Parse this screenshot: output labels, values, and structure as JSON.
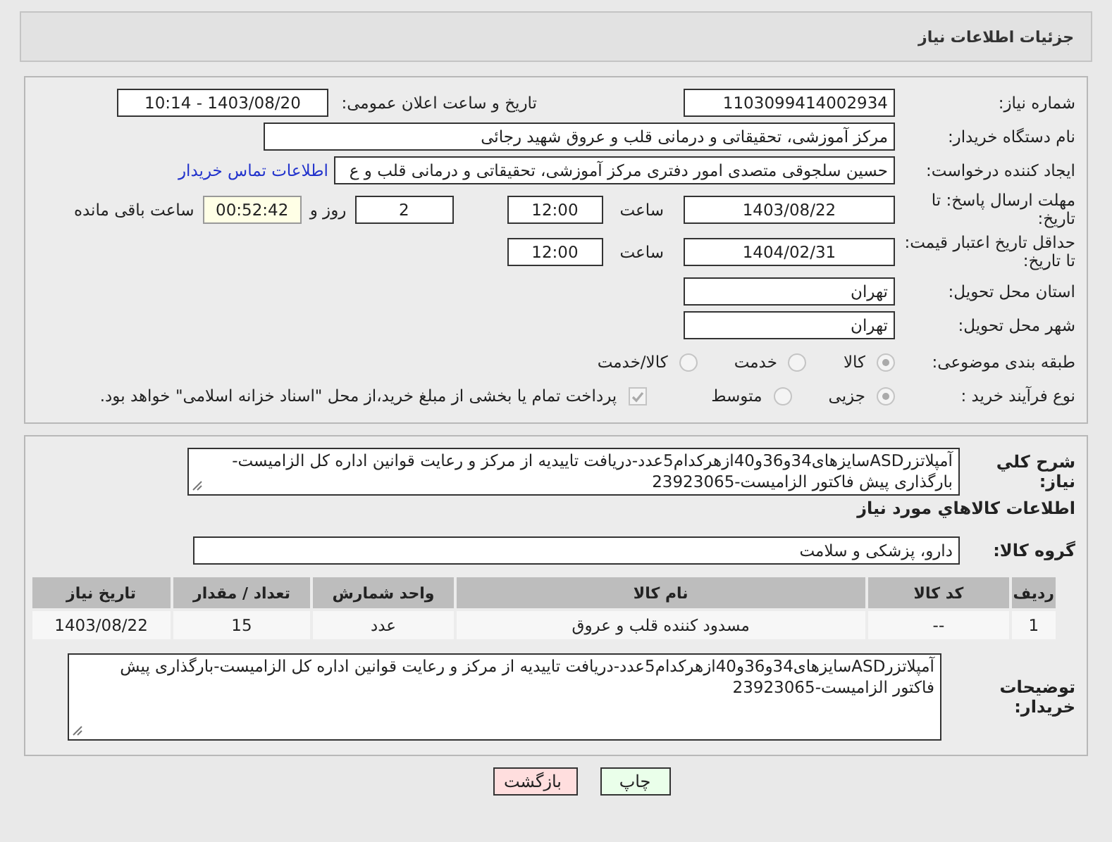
{
  "header": {
    "title": "جزئیات اطلاعات نیاز"
  },
  "details": {
    "need_number": {
      "label": "شماره نیاز:",
      "value": "1103099414002934"
    },
    "announce": {
      "label": "تاریخ و ساعت اعلان عمومی:",
      "value": "1403/08/20 - 10:14"
    },
    "buyer_org": {
      "label": "نام دستگاه خریدار:",
      "value": "مرکز آموزشی، تحقیقاتی و درمانی قلب و عروق شهید رجائی"
    },
    "requester": {
      "label": "ایجاد کننده درخواست:",
      "value": "حسین سلجوقی متصدی امور دفتری مرکز آموزشی، تحقیقاتی و درمانی قلب و ع",
      "link": "اطلاعات تماس خریدار"
    },
    "reply_deadline": {
      "label": "مهلت ارسال پاسخ: تا تاریخ:",
      "date": "1403/08/22",
      "time_label": "ساعت",
      "time": "12:00",
      "days": "2",
      "days_label": "روز و",
      "remaining": "00:52:42",
      "remaining_label": "ساعت باقی مانده"
    },
    "price_validity": {
      "label": "حداقل تاریخ اعتبار قیمت: تا تاریخ:",
      "date": "1404/02/31",
      "time_label": "ساعت",
      "time": "12:00"
    },
    "province": {
      "label": "استان محل تحویل:",
      "value": "تهران"
    },
    "city": {
      "label": "شهر محل تحویل:",
      "value": "تهران"
    },
    "category": {
      "label": "طبقه بندی موضوعی:",
      "options": [
        {
          "label": "کالا",
          "selected": true
        },
        {
          "label": "خدمت",
          "selected": false
        },
        {
          "label": "کالا/خدمت",
          "selected": false
        }
      ]
    },
    "process": {
      "label": "نوع فرآیند خرید :",
      "options": [
        {
          "label": "جزیی",
          "selected": true
        },
        {
          "label": "متوسط",
          "selected": false
        }
      ],
      "payment": {
        "checked": true,
        "text": "پرداخت تمام یا بخشی از مبلغ خرید،از محل \"اسناد خزانه اسلامی\" خواهد بود."
      }
    }
  },
  "description": {
    "label": "شرح کلي نیاز:",
    "value": "آمپلاتزرASDسایزهای34و36و40ازهرکدام5عدد-دریافت تاییدیه از مرکز و رعایت قوانین اداره کل الزامیست-بارگذاری پیش فاکتور الزامیست-23923065"
  },
  "items_heading": "اطلاعات کالاهاي مورد نیاز",
  "goods_group": {
    "label": "گروه کالا:",
    "value": "دارو، پزشکی و سلامت"
  },
  "table": {
    "columns": [
      "ردیف",
      "کد کالا",
      "نام کالا",
      "واحد شمارش",
      "تعداد / مقدار",
      "تاریخ نیاز"
    ],
    "rows": [
      [
        "1",
        "--",
        "مسدود کننده قلب و عروق",
        "عدد",
        "15",
        "1403/08/22"
      ]
    ]
  },
  "buyer_notes": {
    "label": "توضیحات خریدار:",
    "value": "آمپلاتزرASDسایزهای34و36و40ازهرکدام5عدد-دریافت تاییدیه از مرکز و رعایت قوانین اداره کل الزامیست-بارگذاری پیش فاکتور الزامیست-23923065"
  },
  "buttons": [
    {
      "label": "چاپ",
      "kind": "print"
    },
    {
      "label": "بازگشت",
      "kind": "back"
    }
  ]
}
